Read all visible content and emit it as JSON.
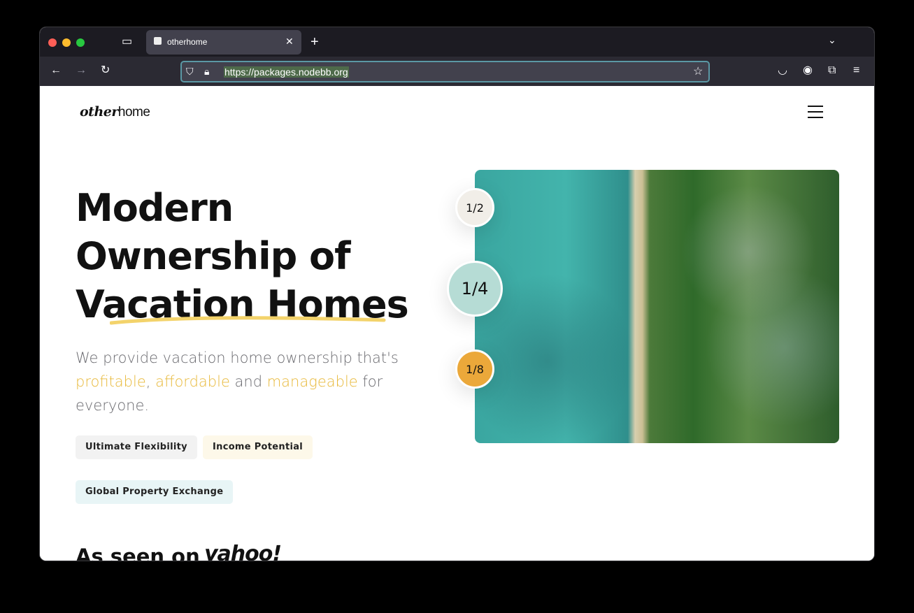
{
  "browser": {
    "tab_title": "otherhome",
    "url": "https://packages.nodebb.org"
  },
  "header": {
    "logo_bold": "other",
    "logo_rest": "home"
  },
  "hero": {
    "title_lines": [
      "Modern",
      "Ownership of",
      "Vacation Homes"
    ],
    "lead": {
      "p1": "We provide vacation home ownership that's ",
      "h1": "profitable",
      "p2": ", ",
      "h2": "affordable",
      "p3": " and ",
      "h3": "manageable",
      "p4": " for everyone."
    },
    "chips": [
      {
        "label": "Ultimate Flexibility",
        "color": "#f2f2f2"
      },
      {
        "label": "Income Potential",
        "color": "#fdf8e9"
      },
      {
        "label": "Global Property Exchange",
        "color": "#e8f5f6"
      }
    ],
    "fractions": [
      {
        "label": "1/2",
        "color": "#f1eee8"
      },
      {
        "label": "1/4",
        "color": "#b6dcd5"
      },
      {
        "label": "1/8",
        "color": "#eba83a"
      }
    ]
  },
  "press": {
    "label": "As seen on",
    "logo": "yahoo!"
  },
  "colors": {
    "accent": "#e8b93a",
    "underline": "#f3d36b"
  }
}
